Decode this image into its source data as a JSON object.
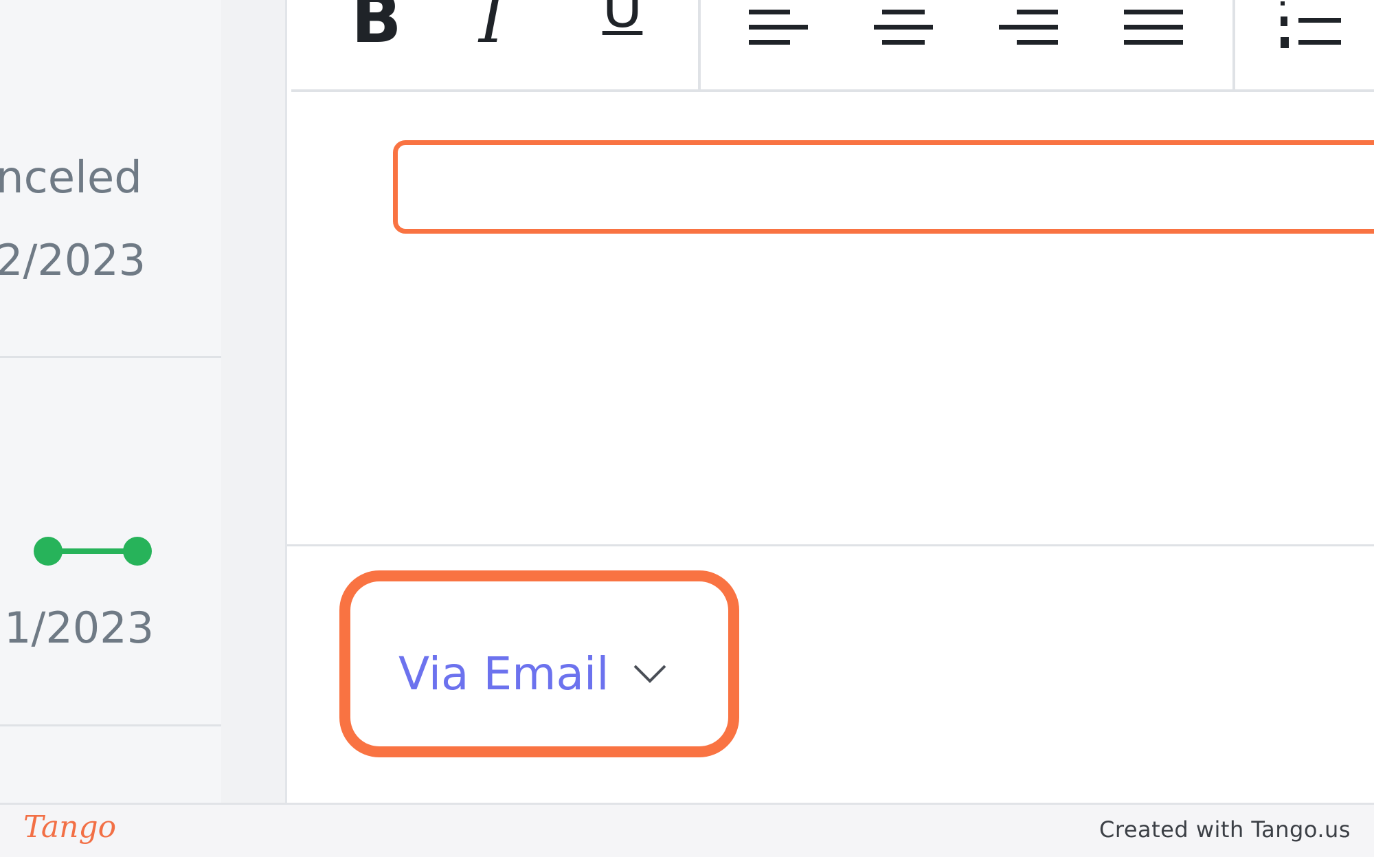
{
  "list": {
    "row1": {
      "status": "nceled",
      "date": "2/2023"
    },
    "row2": {
      "date": "1/2023"
    }
  },
  "toolbar": {
    "bold_label": "B",
    "italic_label": "I",
    "underline_label": "U"
  },
  "reply": {
    "send_via_label": "Via Email"
  },
  "footer": {
    "logo": "Tango",
    "credit": "Created with Tango.us"
  },
  "colors": {
    "highlight": "#f97342",
    "accent": "#6c72ee",
    "connector": "#27b35a"
  }
}
